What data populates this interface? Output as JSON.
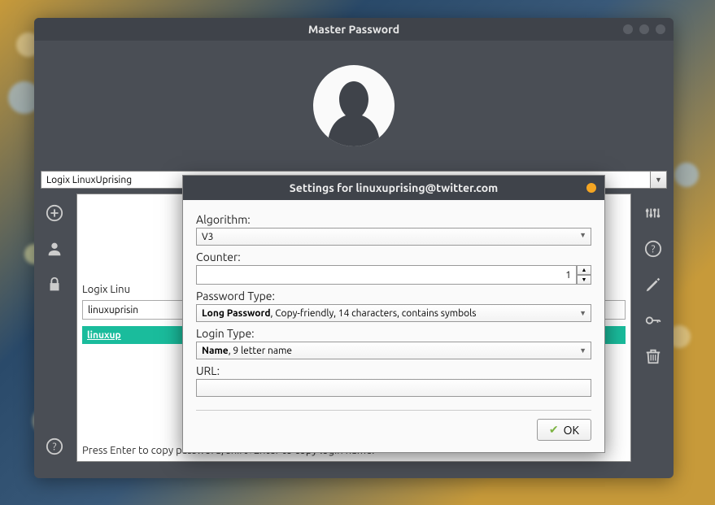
{
  "window": {
    "title": "Master Password"
  },
  "user_field": {
    "value": "Logix LinuxUprising"
  },
  "main": {
    "site_label_prefix": "Logix Linu",
    "site_input_value": "linuxuprisin",
    "selected_row": "linuxup",
    "hint": "Press Enter to copy password, shift+Enter to copy login name."
  },
  "dialog": {
    "title": "Settings for linuxuprising@twitter.com",
    "algorithm_label": "Algorithm:",
    "algorithm_value": "V3",
    "counter_label": "Counter:",
    "counter_value": "1",
    "password_type_label": "Password Type:",
    "password_type_bold": "Long Password",
    "password_type_rest": ", Copy-friendly, 14 characters, contains symbols",
    "login_type_label": "Login Type:",
    "login_type_bold": "Name",
    "login_type_rest": ", 9 letter name",
    "url_label": "URL:",
    "url_value": "",
    "ok_label": "OK"
  }
}
